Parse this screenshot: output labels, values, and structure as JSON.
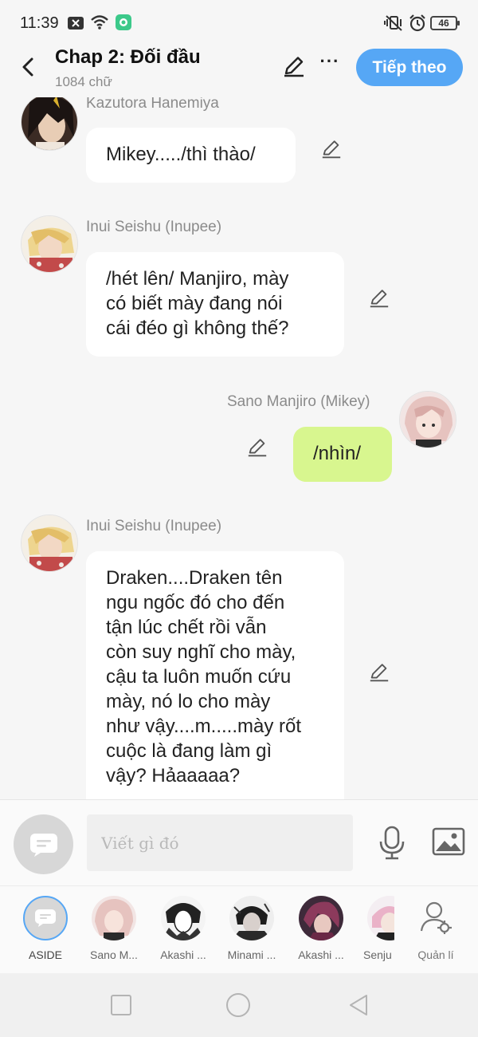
{
  "status_bar": {
    "time": "11:39",
    "battery": "46"
  },
  "header": {
    "title": "Chap 2: Đối đầu",
    "word_count": "1084 chữ",
    "next_button": "Tiếp theo"
  },
  "messages": [
    {
      "sender": "Kazutora Hanemiya",
      "text": "Mikey...../thì thào/",
      "mine": false
    },
    {
      "sender": "Inui Seishu (Inupee)",
      "lines": [
        "/hét lên/ Manjiro, mày",
        "có biết mày đang nói",
        "cái đéo gì không thế?"
      ],
      "mine": false
    },
    {
      "sender": "Sano Manjiro (Mikey)",
      "text": "/nhìn/",
      "mine": true
    },
    {
      "sender": "Inui Seishu (Inupee)",
      "lines": [
        "Draken....Draken tên",
        "ngu ngốc đó cho đến",
        "tận lúc chết rồi vẫn",
        "còn suy nghĩ cho mày,",
        "cậu ta luôn muốn cứu",
        "mày, nó lo cho mày",
        "như vậy....m.....mày rốt",
        "cuộc là đang làm gì",
        "vậy? Hảaaaaa?"
      ],
      "mine": false
    }
  ],
  "input": {
    "placeholder": "Viết gì đó"
  },
  "characters": [
    {
      "label": "ASIDE"
    },
    {
      "label": "Sano M..."
    },
    {
      "label": "Akashi ..."
    },
    {
      "label": "Minami ..."
    },
    {
      "label": "Akashi ..."
    },
    {
      "label": "Senju"
    },
    {
      "label": "Quản lí"
    }
  ],
  "colors": {
    "accent": "#56a7f5",
    "my_bubble": "#d8f68f",
    "other_bubble": "#ffffff"
  }
}
